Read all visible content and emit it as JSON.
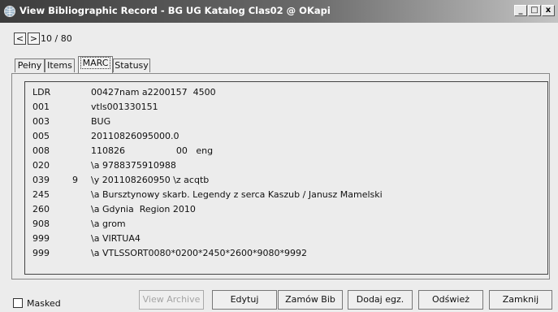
{
  "window": {
    "title": "View Bibliographic Record - BG UG Katalog Clas02 @ OKapi",
    "controls": [
      "_",
      "□",
      "x"
    ]
  },
  "navigation": {
    "prev_label": "<",
    "next_label": ">",
    "counter": "10 / 80"
  },
  "tabs": [
    {
      "label": "Pełny"
    },
    {
      "label": "Items"
    },
    {
      "label": "MARC"
    },
    {
      "label": "Statusy"
    }
  ],
  "active_tab": "MARC",
  "marc": {
    "rows": [
      {
        "tag": "LDR",
        "ind": "",
        "value": "00427nam a2200157  4500"
      },
      {
        "tag": "001",
        "ind": "",
        "value": "vtls001330151"
      },
      {
        "tag": "003",
        "ind": "",
        "value": "BUG"
      },
      {
        "tag": "005",
        "ind": "",
        "value": "20110826095000.0"
      },
      {
        "tag": "008",
        "ind": "",
        "value": "110826                  00   eng"
      },
      {
        "tag": "020",
        "ind": "",
        "value": "\\a 9788375910988"
      },
      {
        "tag": "039",
        "ind": "9",
        "value": "\\y 201108260950 \\z acqtb"
      },
      {
        "tag": "245",
        "ind": "",
        "value": "\\a Bursztynowy skarb. Legendy z serca Kaszub / Janusz Mamelski"
      },
      {
        "tag": "260",
        "ind": "",
        "value": "\\a Gdynia  Region 2010"
      },
      {
        "tag": "908",
        "ind": "",
        "value": "\\a grom"
      },
      {
        "tag": "999",
        "ind": "",
        "value": "\\a VIRTUA4"
      },
      {
        "tag": "999",
        "ind": "",
        "value": "\\a VTLSSORT0080*0200*2450*2600*9080*9992"
      }
    ]
  },
  "footer": {
    "masked_label": "Masked",
    "masked_checked": false,
    "buttons": [
      {
        "label": "View Archive",
        "enabled": false
      },
      {
        "label": "Edytuj",
        "enabled": true
      },
      {
        "label": "Zamów Bib",
        "enabled": true
      },
      {
        "label": "Dodaj egz.",
        "enabled": true
      },
      {
        "label": "Odśwież",
        "enabled": true
      },
      {
        "label": "Zamknij",
        "enabled": true
      }
    ]
  },
  "icons": {
    "app": "globe-icon"
  }
}
